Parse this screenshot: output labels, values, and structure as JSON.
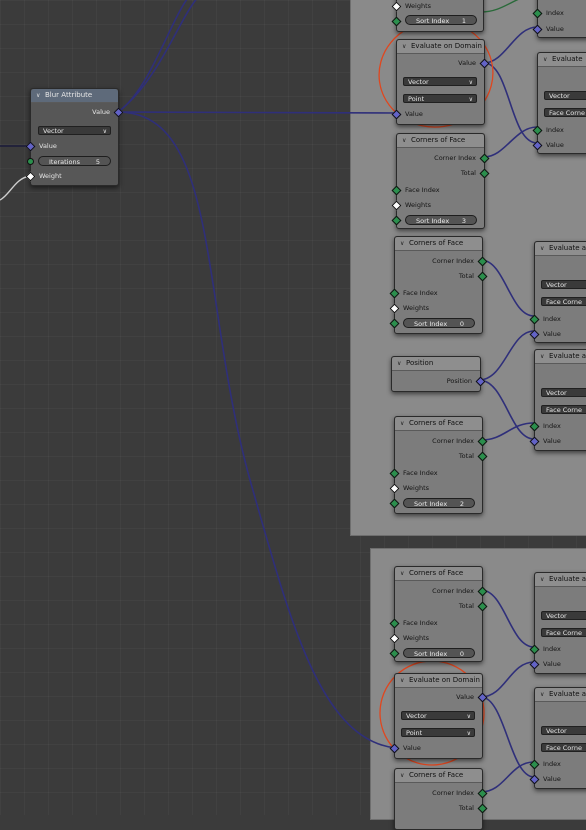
{
  "colors": {
    "vector_socket": "#6363c7",
    "integer_socket": "#2b8f4d",
    "float_socket": "#a1a1a1",
    "wire": "#3d3d8a",
    "annotation": "#e0461e",
    "frame": "#8a8a8a",
    "canvas": "#3b3b3b"
  },
  "blur": {
    "title": "Blur Attribute",
    "out_value": "Value",
    "type": "Vector",
    "in_value": "Value",
    "iter_label": "Iterations",
    "iter_value": "5",
    "weight": "Weight"
  },
  "corners_top": {
    "weights": "Weights",
    "sort_label": "Sort Index",
    "sort_value": "1"
  },
  "eval_top": {
    "title": "Evaluate on Domain",
    "out_value": "Value",
    "type": "Vector",
    "domain": "Point",
    "in_value": "Value"
  },
  "corners": [
    {
      "title": "Corners of Face",
      "corner_index": "Corner Index",
      "total": "Total",
      "face_index": "Face Index",
      "weights": "Weights",
      "sort_label": "Sort Index",
      "sort_value": "3"
    },
    {
      "title": "Corners of Face",
      "corner_index": "Corner Index",
      "total": "Total",
      "face_index": "Face Index",
      "weights": "Weights",
      "sort_label": "Sort Index",
      "sort_value": "0"
    },
    {
      "title": "Corners of Face",
      "corner_index": "Corner Index",
      "total": "Total",
      "face_index": "Face Index",
      "weights": "Weights",
      "sort_label": "Sort Index",
      "sort_value": "2"
    },
    {
      "title": "Corners of Face",
      "corner_index": "Corner Index",
      "total": "Total",
      "face_index": "Face Index",
      "weights": "Weights",
      "sort_label": "Sort Index",
      "sort_value": "0"
    },
    {
      "title": "Corners of Face",
      "corner_index": "Corner Index",
      "total": "Total"
    }
  ],
  "position": {
    "title": "Position",
    "out": "Position"
  },
  "eval_bottom": {
    "title": "Evaluate on Domain",
    "out_value": "Value",
    "type": "Vector",
    "domain": "Point",
    "in_value": "Value"
  },
  "right_partial": {
    "top": {
      "index": "Index",
      "value": "Value"
    },
    "nodes": [
      {
        "title": "Evaluate",
        "type": "Vector",
        "domain": "Face Corne",
        "index": "Index",
        "value": "Value"
      },
      {
        "title": "Evaluate a",
        "type": "Vector",
        "domain": "Face Corne",
        "index": "Index",
        "value": "Value"
      },
      {
        "title": "Evaluate a",
        "type": "Vector",
        "domain": "Face Corne",
        "index": "Index",
        "value": "Value"
      },
      {
        "title": "Evaluate a",
        "type": "Vector",
        "domain": "Face Corne",
        "index": "Index",
        "value": "Value"
      },
      {
        "title": "Evaluate a",
        "type": "Vector",
        "domain": "Face Corne",
        "index": "Index",
        "value": "Value"
      }
    ]
  }
}
